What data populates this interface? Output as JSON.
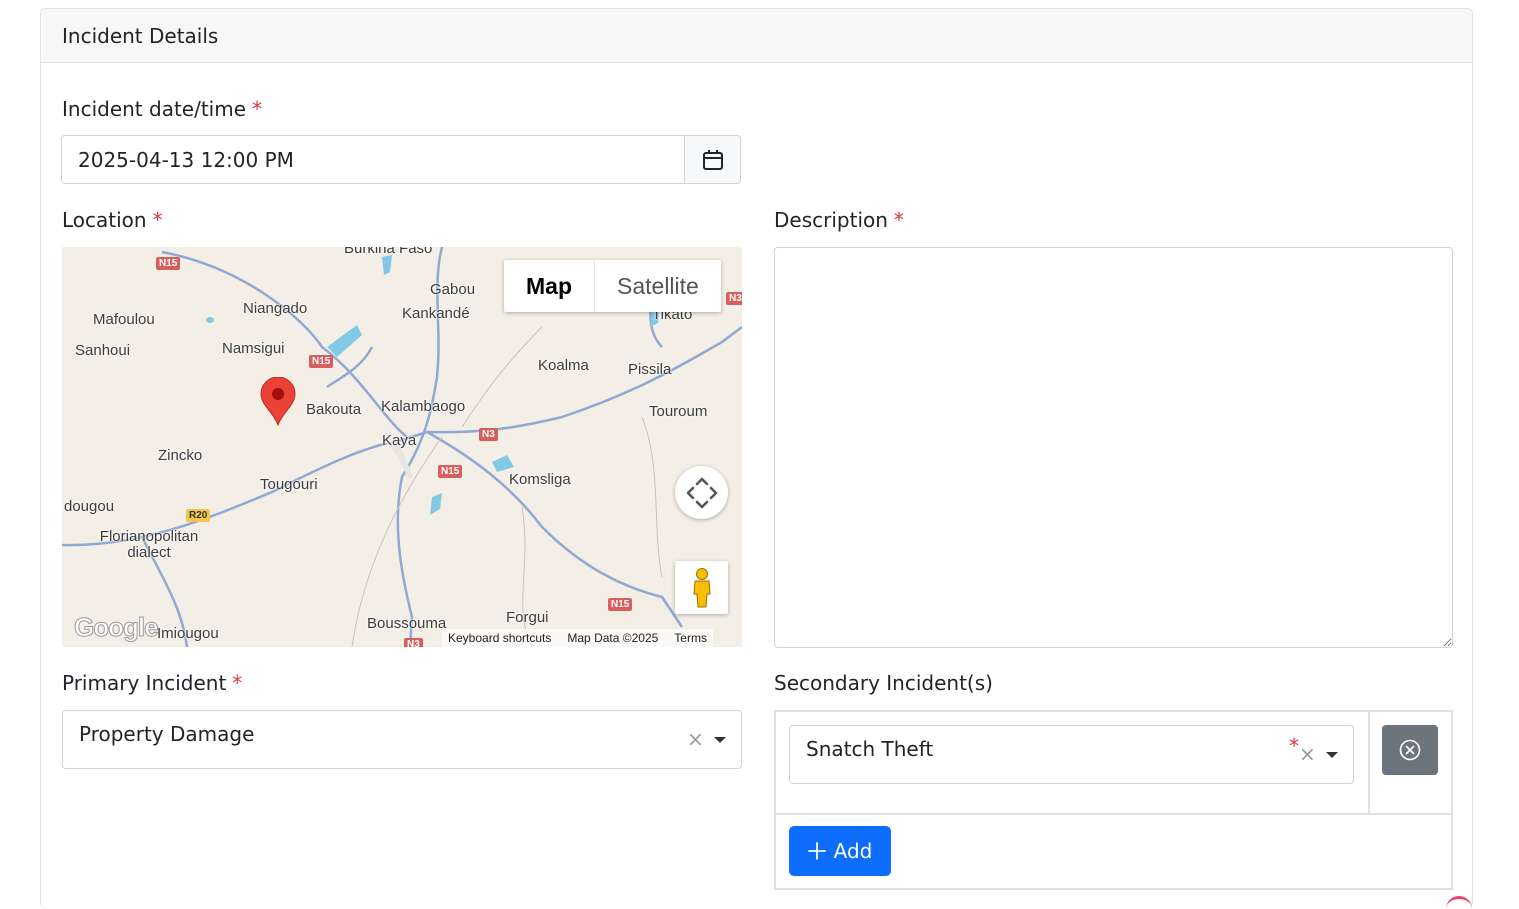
{
  "card": {
    "title": "Incident Details"
  },
  "incident_datetime": {
    "label": "Incident date/time",
    "required": "*",
    "value": "2025-04-13 12:00 PM"
  },
  "location": {
    "label": "Location",
    "required": "*",
    "map": {
      "type_map": "Map",
      "type_satellite": "Satellite",
      "footer": {
        "shortcuts": "Keyboard shortcuts",
        "data": "Map Data ©2025",
        "terms": "Terms"
      },
      "logo": "Google",
      "places": [
        "Burkina Faso",
        "Gabou",
        "Niangado",
        "Kankandé",
        "Mafoulou",
        "Sanhoui",
        "Namsigui",
        "Koalma",
        "Pissila",
        "Tikato",
        "Bakouta",
        "Kalambaogo",
        "Touroum",
        "Kaya",
        "Zincko",
        "Komsliga",
        "Tougouri",
        "dougou",
        "Florianopolitan dialect",
        "Boussouma",
        "Forgui",
        "Imiougou"
      ],
      "shields": [
        "N15",
        "N15",
        "N3",
        "N3",
        "N15",
        "R20",
        "N15",
        "N3"
      ]
    }
  },
  "description": {
    "label": "Description",
    "required": "*",
    "value": ""
  },
  "primary_incident": {
    "label": "Primary Incident",
    "required": "*",
    "value": "Property Damage",
    "clear": "×"
  },
  "secondary_incidents": {
    "label": "Secondary Incident(s)",
    "items": [
      {
        "value": "Snatch Theft",
        "required": "*",
        "clear": "×"
      }
    ],
    "add_label": "Add"
  }
}
